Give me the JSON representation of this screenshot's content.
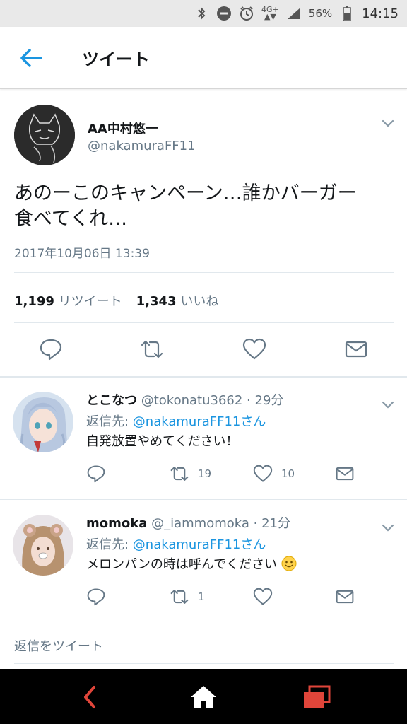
{
  "status_bar": {
    "network": "4G+",
    "battery": "56%",
    "time": "14:15",
    "icons": [
      "bluetooth-icon",
      "do-not-disturb-icon",
      "alarm-icon",
      "network-icon",
      "signal-icon",
      "battery-icon"
    ]
  },
  "app_bar": {
    "title": "ツイート",
    "back_icon": "arrow-left-icon"
  },
  "main_tweet": {
    "name": "AA中村悠一",
    "handle": "@nakamuraFF11",
    "text_line1": "あのーこのキャンペーン…誰かバーガー",
    "text_line2": "食べてくれ…",
    "date": "2017年10月06日 13:39",
    "retweet_count": "1,199",
    "retweet_label": "リツイート",
    "like_count": "1,343",
    "like_label": "いいね"
  },
  "replies": [
    {
      "name": "とこなつ",
      "handle": "@tokonatu3662",
      "time": "· 29分",
      "reply_to_label": "返信先: ",
      "reply_to_link": "@nakamuraFF11さん",
      "text": "自発放置やめてください！",
      "retweets": "19",
      "likes": "10"
    },
    {
      "name": "momoka",
      "handle": "@_iammomoka",
      "time": "· 21分",
      "reply_to_label": "返信先: ",
      "reply_to_link": "@nakamuraFF11さん",
      "text": "メロンパンの時は呼んでください",
      "retweets": "1",
      "likes": ""
    }
  ],
  "reply_box": {
    "placeholder": "返信をツイート"
  },
  "colors": {
    "accent": "#1b95e0",
    "muted": "#657786",
    "nav_back": "#e0453a",
    "nav_recent": "#e0453a"
  }
}
